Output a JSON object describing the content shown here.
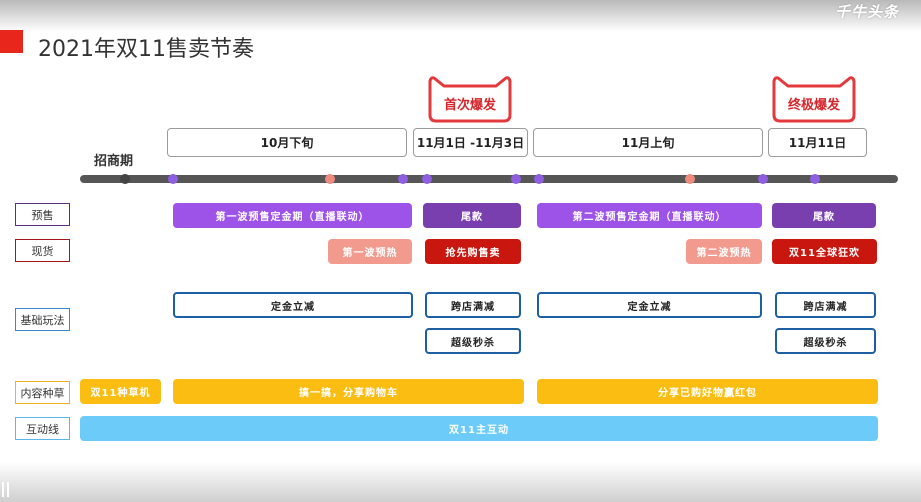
{
  "watermark": "千牛头条",
  "title": "2021年双11售卖节奏",
  "badges": {
    "first": "首次爆发",
    "final": "终极爆发"
  },
  "periods": [
    "10月下旬",
    "11月1日 -11月3日",
    "11月上旬",
    "11月11日"
  ],
  "recruit_label": "招商期",
  "rows": {
    "presale": {
      "label": "预售",
      "items": [
        "第一波预售定金期（直播联动）",
        "尾款",
        "第二波预售定金期（直播联动）",
        "尾款"
      ]
    },
    "spot": {
      "label": "现货",
      "items": [
        "第一波预热",
        "抢先购售卖",
        "第二波预热",
        "双11全球狂欢"
      ]
    },
    "basic": {
      "label": "基础玩法",
      "items": [
        "定金立减",
        "跨店满减",
        "定金立减",
        "跨店满减",
        "超级秒杀",
        "超级秒杀"
      ]
    },
    "content": {
      "label": "内容种草",
      "items": [
        "双11种草机",
        "搞一搞，分享购物车",
        "分享已购好物赢红包"
      ]
    },
    "interactive": {
      "label": "互动线",
      "items": [
        "双11主互动"
      ]
    }
  },
  "colors": {
    "accent": "#e8261c",
    "badge": "#e4393c",
    "timeline": "#565656",
    "dot_purple": "#8e5fe0",
    "dot_salmon": "#ee8a7e",
    "presale": "#9d52e8",
    "presale_final": "#7a3fae",
    "preheat": "#f39a8e",
    "spot": "#c9170f",
    "basic": "#1d5fa0",
    "content": "#fbbd12",
    "interactive": "#6ccbf8",
    "presale_label": "#5b2e86",
    "spot_label": "#a3161b",
    "basic_label": "#3a86c8",
    "content_label": "#f0b020",
    "interactive_label": "#5ab8e8"
  }
}
